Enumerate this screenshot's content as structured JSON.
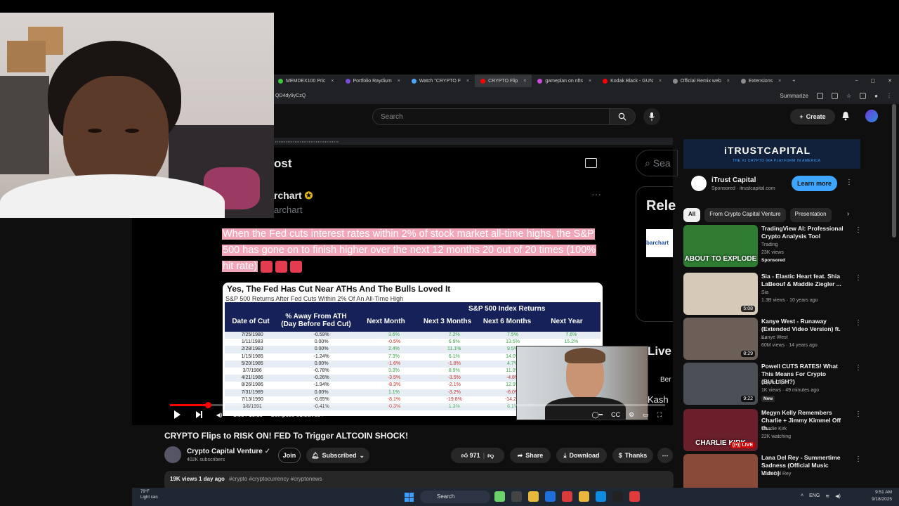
{
  "browser": {
    "tabs": [
      {
        "label": "MEMDEX100 Pric",
        "color": "#3cc43c"
      },
      {
        "label": "Portfolio Raydium",
        "color": "#7a4bd8"
      },
      {
        "label": "Watch \"CRYPTO F",
        "color": "#4aa6ff"
      },
      {
        "label": "CRYPTO Flip",
        "color": "#ff0000"
      },
      {
        "label": "gameplan on nfts",
        "color": "#c84bd8"
      },
      {
        "label": "Kodak Black - GUN",
        "color": "#ff0000"
      },
      {
        "label": "Official Remix web",
        "color": "#8c8c8c"
      },
      {
        "label": "Extensions",
        "color": "#8c8c8c"
      }
    ],
    "url_fragment": "QD4dy9yCzQ",
    "summarize_label": "Summarize"
  },
  "youtube": {
    "search_placeholder": "Search",
    "create_label": "Create"
  },
  "tweet": {
    "header_title": "ost",
    "author_name": "rchart",
    "author_handle": "archart",
    "body": "When the Fed cuts interest rates within 2% of stock market all-time highs, the S&P 500 has gone on to finish higher over the next 12 months 20 out of 20 times (100% hit rate)",
    "side_search": "Sea",
    "side_heading": "Rele",
    "side_logo_text": "barchart",
    "side_live": "Live",
    "side_ber": "Ber",
    "side_kash": "Kash"
  },
  "table": {
    "title": "Yes, The Fed Has Cut Near ATHs And The Bulls Loved It",
    "subtitle": "S&P 500 Returns After Fed Cuts Within 2% Of An All-Time High",
    "band_title": "S&P 500 Index Returns",
    "columns": [
      "Date of Cut",
      "% Away From ATH (Day Before Fed Cut)",
      "Next Month",
      "Next 3 Months",
      "Next 6 Months",
      "Next Year"
    ],
    "rows": [
      {
        "date": "7/25/1980",
        "away": "-0.59%",
        "nm": "3.6%",
        "n3": "7.2%",
        "n6": "7.5%",
        "ny": "7.6%"
      },
      {
        "date": "1/11/1983",
        "away": "0.00%",
        "nm": "-0.5%",
        "n3": "6.9%",
        "n6": "13.5%",
        "ny": "15.2%"
      },
      {
        "date": "2/28/1983",
        "away": "0.00%",
        "nm": "2.4%",
        "n3": "11.1%",
        "n6": "9.5%",
        "ny": ""
      },
      {
        "date": "1/15/1985",
        "away": "-1.24%",
        "nm": "7.3%",
        "n3": "6.1%",
        "n6": "14.0%",
        "ny": ""
      },
      {
        "date": "5/20/1985",
        "away": "0.00%",
        "nm": "-1.6%",
        "n3": "-1.8%",
        "n6": "4.7%",
        "ny": ""
      },
      {
        "date": "3/7/1986",
        "away": "-0.78%",
        "nm": "3.3%",
        "n3": "8.9%",
        "n6": "11.0%",
        "ny": ""
      },
      {
        "date": "4/21/1986",
        "away": "-0.26%",
        "nm": "-3.5%",
        "n3": "-3.5%",
        "n6": "-4.8%",
        "ny": ""
      },
      {
        "date": "8/26/1986",
        "away": "-1.94%",
        "nm": "-8.3%",
        "n3": "-2.1%",
        "n6": "12.9%",
        "ny": ""
      },
      {
        "date": "7/31/1989",
        "away": "0.00%",
        "nm": "1.1%",
        "n3": "-3.2%",
        "n6": "-6.0%",
        "ny": ""
      },
      {
        "date": "7/13/1990",
        "away": "-0.65%",
        "nm": "-8.1%",
        "n3": "-19.8%",
        "n6": "-14.2%",
        "ny": ""
      },
      {
        "date": "3/8/1991",
        "away": "-0.41%",
        "nm": "-0.3%",
        "n3": "1.3%",
        "n6": "6.1%",
        "ny": ""
      }
    ]
  },
  "player": {
    "time": "1:03 / 13:39",
    "chapter": "Compose ourselves"
  },
  "video": {
    "title": "CRYPTO Flips to RISK ON! FED To Trigger ALTCOIN SHOCK!",
    "channel": "Crypto Capital Venture",
    "subscribers": "402K subscribers",
    "join_label": "Join",
    "subscribed_label": "Subscribed",
    "likes": "971",
    "share_label": "Share",
    "download_label": "Download",
    "thanks_label": "Thanks",
    "views": "19K views",
    "age": "1 day ago",
    "hashtags": "#crypto #cryptocurrency #cryptonews"
  },
  "ad": {
    "banner_logo": "iTRUSTCAPITAL",
    "banner_tag": "THE #1 CRYPTO IRA PLATFORM IN AMERICA",
    "name": "iTrust Capital",
    "sponsored": "Sponsored · itrustcapital.com",
    "cta": "Learn more"
  },
  "chips": [
    "All",
    "From Crypto Capital Venture",
    "Presentation"
  ],
  "recommendations": [
    {
      "title": "TradingView AI: Professional Crypto Analysis Tool",
      "channel": "Trading",
      "meta": "23K views",
      "badge": "Sponsored",
      "duration": "",
      "live": false,
      "thumb": "#2e7d32",
      "thumb_text": "ABOUT TO EXPLODE"
    },
    {
      "title": "Sia - Elastic Heart feat. Shia LaBeouf & Maddie Ziegler ...",
      "channel": "Sia",
      "meta": "1.3B views · 10 years ago",
      "badge": "",
      "duration": "5:08",
      "live": false,
      "thumb": "#d7c9b8",
      "thumb_text": ""
    },
    {
      "title": "Kanye West - Runaway (Extended Video Version) ft. ...",
      "channel": "Kanye West",
      "meta": "60M views · 14 years ago",
      "badge": "",
      "duration": "8:29",
      "live": false,
      "thumb": "#6b5f58",
      "thumb_text": ""
    },
    {
      "title": "Powell CUTS RATES! What This Means For Crypto (BULLISH?)",
      "channel": "Crypto Tips",
      "meta": "1K views · 49 minutes ago",
      "badge": "New",
      "duration": "9:22",
      "live": false,
      "thumb": "#4a4e55",
      "thumb_text": ""
    },
    {
      "title": "Megyn Kelly Remembers Charlie + Jimmy Kimmel Off th...",
      "channel": "Charlie Kirk",
      "meta": "22K watching",
      "badge": "",
      "duration": "",
      "live": true,
      "thumb": "#6a1f2a",
      "thumb_text": "CHARLIE KIRK"
    },
    {
      "title": "Lana Del Rey - Summertime Sadness (Official Music Video)",
      "channel": "Lana Del Rey",
      "meta": "",
      "badge": "",
      "duration": "",
      "live": false,
      "thumb": "#8a4a3a",
      "thumb_text": ""
    }
  ],
  "taskbar": {
    "weather_temp": "79°F",
    "weather_desc": "Light rain",
    "search": "Search",
    "lang": "ENG",
    "time": "9:51 AM",
    "date": "9/18/2025"
  },
  "colors": {
    "youtube_red": "#ff0000",
    "tweet_highlight": "#f3a6b8",
    "table_band": "#16215a",
    "link_blue": "#3ea6ff"
  },
  "icons": [
    "search-icon",
    "mic-icon",
    "bell-icon",
    "play-icon",
    "next-icon",
    "volume-icon",
    "settings-icon",
    "fullscreen-icon",
    "like-icon",
    "dislike-icon",
    "share-icon",
    "download-icon",
    "windows-icon"
  ]
}
